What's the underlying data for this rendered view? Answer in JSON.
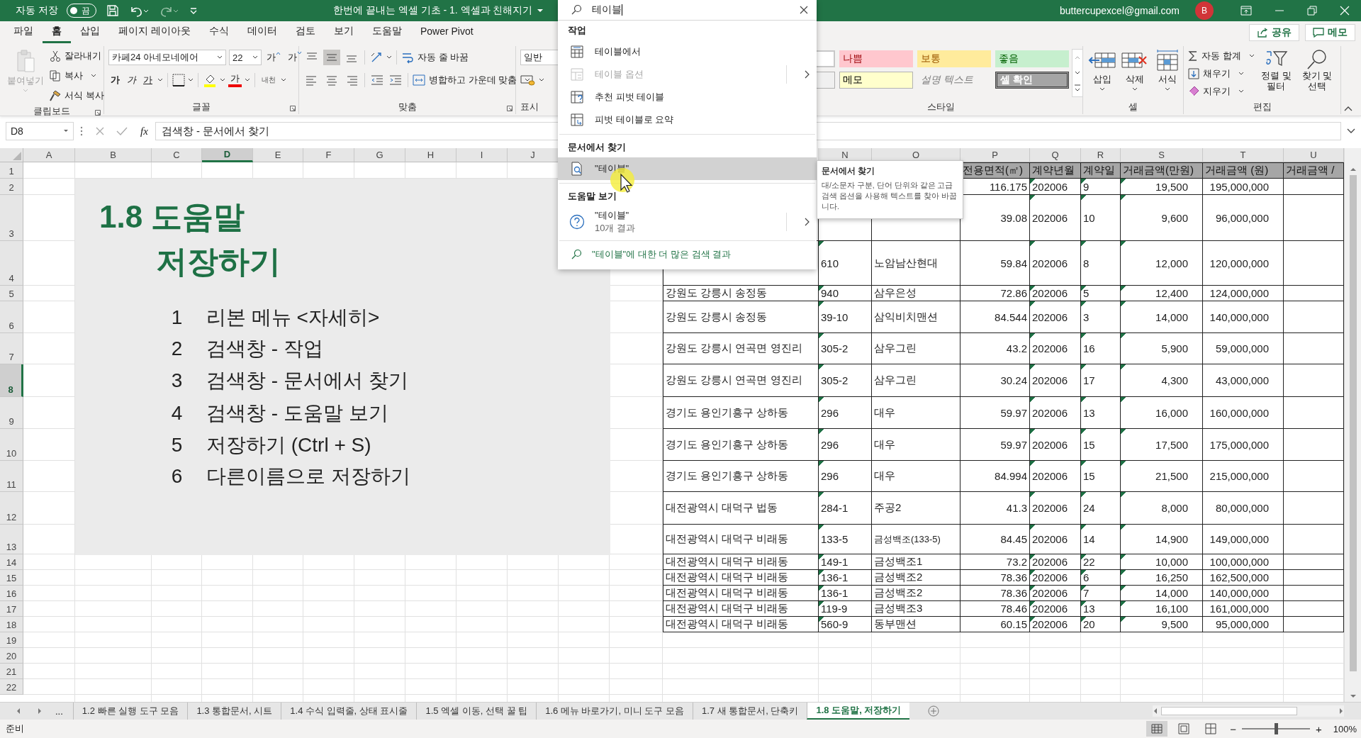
{
  "title_bar": {
    "autosave_label": "자동 저장",
    "autosave_on": false,
    "autosave_state": "끔",
    "document_title": "한번에 끝내는 엑셀 기초 - 1. 엑셀과 친해지기",
    "account": "buttercupexcel@gmail.com",
    "avatar": "B"
  },
  "ribbon_tabs": [
    {
      "label": "파일",
      "selected": false
    },
    {
      "label": "홈",
      "selected": true
    },
    {
      "label": "삽입",
      "selected": false
    },
    {
      "label": "페이지 레이아웃",
      "selected": false
    },
    {
      "label": "수식",
      "selected": false
    },
    {
      "label": "데이터",
      "selected": false
    },
    {
      "label": "검토",
      "selected": false
    },
    {
      "label": "보기",
      "selected": false
    },
    {
      "label": "도움말",
      "selected": false
    },
    {
      "label": "Power Pivot",
      "selected": false
    }
  ],
  "share_button": "공유",
  "comments_button": "메모",
  "ribbon": {
    "clipboard": {
      "label": "클립보드",
      "paste": "붙여넣기",
      "paste_disabled": true,
      "cut": "잘라내기",
      "copy": "복사",
      "format_painter": "서식 복사"
    },
    "font": {
      "label": "글꼴",
      "font_name": "카페24 아네모네에어",
      "font_size": "22",
      "grow": "가",
      "shrink": "가",
      "bold": "가",
      "italic": "가",
      "underline": "가",
      "font_color": "가",
      "phonetic": "내천"
    },
    "alignment": {
      "label": "맞춤",
      "vertical": [
        {
          "kind": "top",
          "selected": false
        },
        {
          "kind": "middle",
          "selected": true
        },
        {
          "kind": "bottom",
          "selected": false
        }
      ],
      "wrap_text": "자동 줄 바꿈",
      "merge_center": "병합하고 가운데 맞춤"
    },
    "number": {
      "label": "표시",
      "format": "일반"
    },
    "styles": {
      "label": "스타일",
      "items": [
        {
          "kind": "blank"
        },
        {
          "kind": "bad",
          "label": "나쁨"
        },
        {
          "kind": "neutral",
          "label": "보통"
        },
        {
          "kind": "good",
          "label": "좋음"
        },
        {
          "kind": "blank_gray"
        },
        {
          "kind": "note",
          "label": "메모"
        },
        {
          "kind": "explanatory",
          "label": "설명 텍스트"
        },
        {
          "kind": "check",
          "label": "셀 확인"
        }
      ]
    },
    "cells": {
      "label": "셀",
      "buttons": [
        {
          "kind": "insert",
          "label": "삽입"
        },
        {
          "kind": "delete",
          "label": "삭제"
        },
        {
          "kind": "format",
          "label": "서식"
        }
      ]
    },
    "editing": {
      "label": "편집",
      "autosum": "자동 합계",
      "fill": "채우기",
      "clear": "지우기",
      "sort": "정렬 및 필터",
      "find": "찾기 및 선택"
    }
  },
  "formula_bar": {
    "name_box": "D8",
    "function_label": "fx",
    "formula": "검색창 - 문서에서 찾기"
  },
  "sheet": {
    "columns": [
      {
        "letter": "A",
        "selected": false
      },
      {
        "letter": "B",
        "selected": false
      },
      {
        "letter": "C",
        "selected": false
      },
      {
        "letter": "D",
        "selected": true
      },
      {
        "letter": "E",
        "selected": false
      },
      {
        "letter": "F",
        "selected": false
      },
      {
        "letter": "G",
        "selected": false
      },
      {
        "letter": "H",
        "selected": false
      },
      {
        "letter": "I",
        "selected": false
      },
      {
        "letter": "J",
        "selected": false
      },
      {},
      {},
      {},
      {
        "letter": "N",
        "selected": false
      },
      {
        "letter": "O",
        "selected": false
      },
      {
        "letter": "P",
        "selected": false
      },
      {
        "letter": "Q",
        "selected": false
      },
      {
        "letter": "R",
        "selected": false
      },
      {
        "letter": "S",
        "selected": false
      },
      {
        "letter": "T",
        "selected": false
      },
      {
        "letter": "U",
        "selected": false
      }
    ],
    "rows": [
      {
        "number": "1",
        "selected": false
      },
      {
        "number": "2",
        "selected": false
      },
      {
        "number": "3",
        "selected": false
      },
      {
        "number": "4",
        "selected": false
      },
      {
        "number": "5",
        "selected": false
      },
      {
        "number": "6",
        "selected": false
      },
      {
        "number": "7",
        "selected": false
      },
      {
        "number": "8",
        "selected": true
      },
      {
        "number": "9",
        "selected": false
      },
      {
        "number": "10",
        "selected": false
      },
      {
        "number": "11",
        "selected": false
      },
      {
        "number": "12",
        "selected": false
      },
      {
        "number": "13",
        "selected": false
      },
      {
        "number": "14",
        "selected": false
      },
      {
        "number": "15",
        "selected": false
      },
      {
        "number": "16",
        "selected": false
      },
      {
        "number": "17",
        "selected": false
      },
      {
        "number": "18",
        "selected": false
      },
      {
        "number": "19",
        "selected": false
      },
      {
        "number": "20",
        "selected": false
      },
      {
        "number": "21",
        "selected": false
      },
      {
        "number": "22",
        "selected": false
      }
    ],
    "panel": {
      "title_lines": [
        "1.8 도움말",
        "저장하기"
      ],
      "items": [
        {
          "number": "1",
          "text": "리본 메뉴 <자세히>"
        },
        {
          "number": "2",
          "text": "검색창 - 작업"
        },
        {
          "number": "3",
          "text": "검색창 - 문서에서 찾기"
        },
        {
          "number": "4",
          "text": "검색창 - 도움말 보기"
        },
        {
          "number": "5",
          "text": "저장하기 (Ctrl + S)"
        },
        {
          "number": "6",
          "text": "다른이름으로 저장하기"
        }
      ]
    },
    "table": {
      "columns": [
        {
          "kind": "text",
          "flagged": false
        },
        {
          "kind": "text",
          "flagged": true
        },
        {
          "kind": "text",
          "flagged": false
        },
        {
          "kind": "number",
          "flagged": false,
          "header": "전용면적(㎡)"
        },
        {
          "kind": "text",
          "flagged": true,
          "header": "계약년월"
        },
        {
          "kind": "text",
          "flagged": true,
          "header": "계약일"
        },
        {
          "kind": "amount",
          "flagged": true,
          "header": "거래금액(만원)"
        },
        {
          "kind": "amount",
          "flagged": false,
          "header": "거래금액 (원)"
        },
        {
          "kind": "text",
          "flagged": false,
          "header": "거래금액 /"
        }
      ],
      "rows": [
        {
          "cells": [
            null,
            null,
            null,
            "116.175",
            "202006",
            "9",
            "19,500",
            "195,000,000"
          ]
        },
        {
          "cells": [
            null,
            null,
            null,
            "39.08",
            "202006",
            "10",
            "9,600",
            "96,000,000"
          ]
        },
        {
          "cells": [
            null,
            "610",
            "노암남산현대",
            "59.84",
            "202006",
            "8",
            "12,000",
            "120,000,000"
          ]
        },
        {
          "cells": [
            "강원도 강릉시 송정동",
            "940",
            "삼우은성",
            "72.86",
            "202006",
            "5",
            "12,400",
            "124,000,000"
          ]
        },
        {
          "cells": [
            "강원도 강릉시 송정동",
            "39-10",
            "삼익비치맨션",
            "84.544",
            "202006",
            "3",
            "14,000",
            "140,000,000"
          ]
        },
        {
          "cells": [
            "강원도 강릉시 연곡면 영진리",
            "305-2",
            "삼우그린",
            "43.2",
            "202006",
            "16",
            "5,900",
            "59,000,000"
          ]
        },
        {
          "cells": [
            "강원도 강릉시 연곡면 영진리",
            "305-2",
            "삼우그린",
            "30.24",
            "202006",
            "17",
            "4,300",
            "43,000,000"
          ]
        },
        {
          "cells": [
            "경기도 용인기흥구 상하동",
            "296",
            "대우",
            "59.97",
            "202006",
            "13",
            "16,000",
            "160,000,000"
          ]
        },
        {
          "cells": [
            "경기도 용인기흥구 상하동",
            "296",
            "대우",
            "59.97",
            "202006",
            "15",
            "17,500",
            "175,000,000"
          ]
        },
        {
          "cells": [
            "경기도 용인기흥구 상하동",
            "296",
            "대우",
            "84.994",
            "202006",
            "15",
            "21,500",
            "215,000,000"
          ]
        },
        {
          "cells": [
            "대전광역시 대덕구 법동",
            "284-1",
            "주공2",
            "41.3",
            "202006",
            "24",
            "8,000",
            "80,000,000"
          ]
        },
        {
          "cells": [
            "대전광역시 대덕구 비래동",
            "133-5",
            "금성백조(133-5)",
            "84.45",
            "202006",
            "14",
            "14,900",
            "149,000,000"
          ]
        },
        {
          "cells": [
            "대전광역시 대덕구 비래동",
            "149-1",
            "금성백조1",
            "73.2",
            "202006",
            "22",
            "10,000",
            "100,000,000"
          ]
        },
        {
          "cells": [
            "대전광역시 대덕구 비래동",
            "136-1",
            "금성백조2",
            "78.36",
            "202006",
            "6",
            "16,250",
            "162,500,000"
          ]
        },
        {
          "cells": [
            "대전광역시 대덕구 비래동",
            "136-1",
            "금성백조2",
            "78.36",
            "202006",
            "7",
            "14,000",
            "140,000,000"
          ]
        },
        {
          "cells": [
            "대전광역시 대덕구 비래동",
            "119-9",
            "금성백조3",
            "78.46",
            "202006",
            "13",
            "16,100",
            "161,000,000"
          ]
        },
        {
          "cells": [
            "대전광역시 대덕구 비래동",
            "560-9",
            "동부맨션",
            "60.15",
            "202006",
            "20",
            "9,500",
            "95,000,000"
          ]
        }
      ]
    }
  },
  "search": {
    "value": "테이블",
    "sections": [
      {
        "heading": "작업",
        "items": [
          {
            "kind": "table",
            "label": "테이블에서",
            "disabled": false,
            "submenu": false,
            "selected": false
          },
          {
            "kind": "table_options",
            "label": "테이블 옵션",
            "disabled": true,
            "submenu": true,
            "selected": false
          },
          {
            "kind": "recommended_pivot",
            "label": "추천 피벗 테이블",
            "disabled": false,
            "submenu": false,
            "selected": false
          },
          {
            "kind": "pivot_summary",
            "label": "피벗 테이블로 요약",
            "disabled": false,
            "submenu": false,
            "selected": false
          }
        ]
      },
      {
        "heading": "문서에서 찾기",
        "items": [
          {
            "kind": "find",
            "label": "\"테이블\"",
            "disabled": false,
            "submenu": false,
            "selected": true
          }
        ]
      },
      {
        "heading": "도움말 보기",
        "items": [
          {
            "kind": "help",
            "label": "\"테이블\"",
            "sublabel": "10개 결과",
            "disabled": false,
            "submenu": true,
            "selected": false
          }
        ]
      }
    ],
    "more_results": "\"테이블\"에 대한 더 많은 검색 결과"
  },
  "tooltip": {
    "title": "문서에서 찾기",
    "body": "대/소문자 구분, 단어 단위와 같은 고급 검색 옵션을 사용해 텍스트를 찾아 바꿉니다."
  },
  "sheet_tabs": {
    "overflow": "...",
    "tabs": [
      {
        "label": "1.2 빠른 실행 도구 모음",
        "selected": false
      },
      {
        "label": "1.3 통합문서, 시트",
        "selected": false
      },
      {
        "label": "1.4 수식 입력줄, 상태 표시줄",
        "selected": false
      },
      {
        "label": "1.5 엑셀 이동, 선택 꿀 팁",
        "selected": false
      },
      {
        "label": "1.6 메뉴 바로가기, 미니 도구 모음",
        "selected": false
      },
      {
        "label": "1.7 새 통합문서, 단축키",
        "selected": false
      },
      {
        "label": "1.8 도움말, 저장하기",
        "selected": true
      }
    ]
  },
  "status_bar": {
    "mode": "준비",
    "views": [
      {
        "kind": "normal",
        "selected": true
      },
      {
        "kind": "page_layout",
        "selected": false
      },
      {
        "kind": "page_break",
        "selected": false
      }
    ],
    "zoom_minus": "−",
    "zoom_plus": "+",
    "zoom": {
      "level": 0.5
    },
    "zoom_text": "100%"
  }
}
